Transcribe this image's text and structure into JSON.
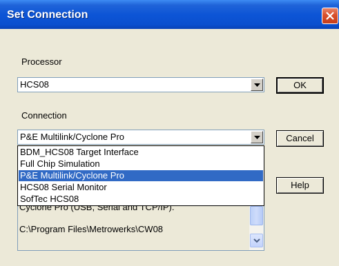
{
  "window": {
    "title": "Set Connection"
  },
  "processor": {
    "label": "Processor",
    "value": "HCS08"
  },
  "connection": {
    "label": "Connection",
    "value": "P&E Multilink/Cyclone Pro",
    "options": [
      "BDM_HCS08 Target Interface",
      "Full Chip Simulation",
      "P&E Multilink/Cyclone Pro",
      "HCS08 Serial Monitor",
      "SofTec HCS08"
    ],
    "selected_index": 2
  },
  "buttons": {
    "ok": "OK",
    "cancel": "Cancel",
    "help": "Help"
  },
  "info": {
    "line1": "Cyclone Pro (USB, Serial and TCP/IP).",
    "line2": "C:\\Program Files\\Metrowerks\\CW08"
  },
  "colors": {
    "selection": "#316ac5",
    "titlebar": "#0a4fcf"
  }
}
